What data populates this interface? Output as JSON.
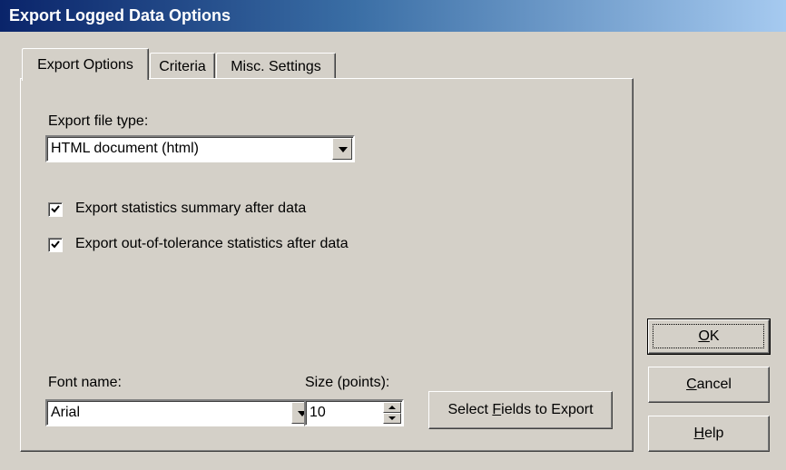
{
  "window": {
    "title": "Export Logged Data Options"
  },
  "tabs": [
    {
      "label": "Export Options",
      "active": true
    },
    {
      "label": "Criteria",
      "active": false
    },
    {
      "label": "Misc. Settings",
      "active": false
    }
  ],
  "export_options": {
    "file_type_label": "Export file type:",
    "file_type_value": "HTML document (html)",
    "checkbox_stats": {
      "label": "Export statistics summary after data",
      "checked": true
    },
    "checkbox_oot": {
      "label": "Export out-of-tolerance statistics after data",
      "checked": true
    },
    "font_name_label": "Font name:",
    "font_name_value": "Arial",
    "size_label": "Size (points):",
    "size_value": "10",
    "select_fields_pre": "Select ",
    "select_fields_accel": "F",
    "select_fields_post": "ields to Export"
  },
  "buttons": {
    "ok_accel": "O",
    "ok_rest": "K",
    "cancel_accel": "C",
    "cancel_rest": "ancel",
    "help_accel": "H",
    "help_rest": "elp"
  }
}
